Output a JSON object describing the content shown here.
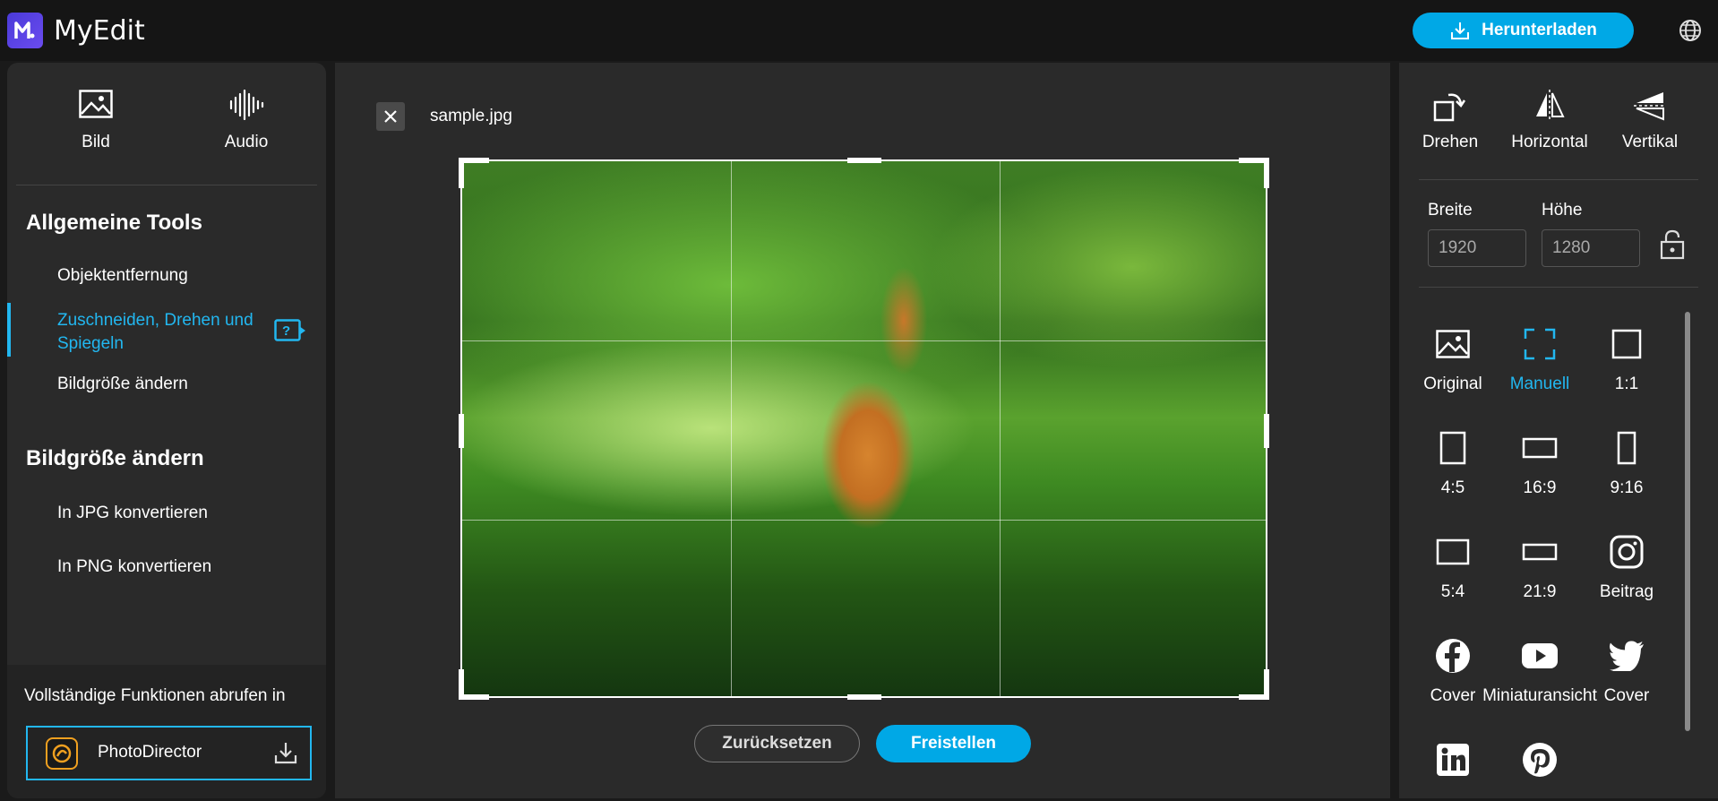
{
  "header": {
    "app_name": "MyEdit",
    "download_label": "Herunterladen"
  },
  "left": {
    "modes": [
      {
        "label": "Bild"
      },
      {
        "label": "Audio"
      }
    ],
    "section1_title": "Allgemeine Tools",
    "section1_items": [
      "Objektentfernung",
      "Zuschneiden, Drehen und Spiegeln",
      "Bildgröße ändern"
    ],
    "active_item_line1": "Zuschneiden, Drehen und",
    "active_item_line2": "Spiegeln",
    "section2_title": "Bildgröße ändern",
    "section2_items": [
      "In JPG konvertieren",
      "In PNG konvertieren"
    ],
    "promo_text": "Vollständige Funktionen abrufen in",
    "promo_app": "PhotoDirector"
  },
  "center": {
    "filename": "sample.jpg",
    "reset_label": "Zurücksetzen",
    "crop_label": "Freistellen"
  },
  "right": {
    "tools": [
      {
        "label": "Drehen"
      },
      {
        "label": "Horizontal"
      },
      {
        "label": "Vertikal"
      }
    ],
    "width_label": "Breite",
    "height_label": "Höhe",
    "width_value": "1920",
    "height_value": "1280",
    "ratios": [
      {
        "label": "Original",
        "icon": "image-icon"
      },
      {
        "label": "Manuell",
        "icon": "manual-crop-icon",
        "active": true
      },
      {
        "label": "1:1",
        "icon": "square-icon"
      },
      {
        "label": "4:5",
        "icon": "portrait-4-5-icon"
      },
      {
        "label": "16:9",
        "icon": "landscape-16-9-icon"
      },
      {
        "label": "9:16",
        "icon": "portrait-9-16-icon"
      },
      {
        "label": "5:4",
        "icon": "landscape-5-4-icon"
      },
      {
        "label": "21:9",
        "icon": "landscape-21-9-icon"
      },
      {
        "label": "Beitrag",
        "icon": "instagram-icon"
      },
      {
        "label": "Cover",
        "icon": "facebook-icon"
      },
      {
        "label": "Miniaturansicht",
        "icon": "youtube-icon"
      },
      {
        "label": "Cover",
        "icon": "twitter-icon"
      },
      {
        "label": "",
        "icon": "linkedin-icon"
      },
      {
        "label": "",
        "icon": "pinterest-icon"
      }
    ]
  },
  "colors": {
    "accent": "#00a8e6",
    "active_text": "#22b7f0",
    "panel": "#2a2a2a",
    "header": "#151515"
  }
}
